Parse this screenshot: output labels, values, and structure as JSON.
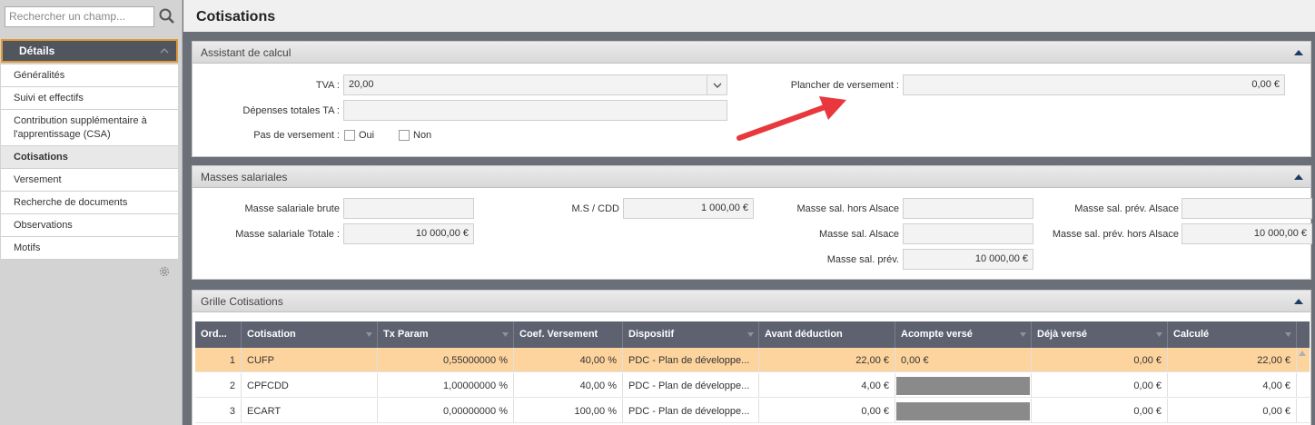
{
  "search": {
    "placeholder": "Rechercher un champ..."
  },
  "sidebar": {
    "header": "Détails",
    "items": [
      {
        "label": "Généralités"
      },
      {
        "label": "Suivi et effectifs"
      },
      {
        "label": "Contribution supplémentaire à l'apprentissage (CSA)"
      },
      {
        "label": "Cotisations"
      },
      {
        "label": "Versement"
      },
      {
        "label": "Recherche de documents"
      },
      {
        "label": "Observations"
      },
      {
        "label": "Motifs"
      }
    ]
  },
  "page": {
    "title": "Cotisations"
  },
  "assistant": {
    "title": "Assistant de calcul",
    "tva_label": "TVA :",
    "tva_value": "20,00",
    "depenses_label": "Dépenses totales TA :",
    "depenses_value": "",
    "pas_label": "Pas de versement :",
    "oui": "Oui",
    "non": "Non",
    "plancher_label": "Plancher de versement :",
    "plancher_value": "0,00 €"
  },
  "masses": {
    "title": "Masses salariales",
    "brute_label": "Masse salariale brute",
    "brute_value": "",
    "totale_label": "Masse salariale Totale :",
    "totale_value": "10 000,00 €",
    "ms_cdd_label": "M.S / CDD",
    "ms_cdd_value": "1 000,00 €",
    "hors_alsace_label": "Masse sal. hors Alsace",
    "hors_alsace_value": "",
    "alsace_label": "Masse sal. Alsace",
    "alsace_value": "",
    "prev_label": "Masse sal. prév.",
    "prev_value": "10 000,00 €",
    "prev_alsace_label": "Masse sal. prév. Alsace",
    "prev_alsace_value": "",
    "prev_hors_alsace_label": "Masse sal. prév. hors Alsace",
    "prev_hors_alsace_value": "10 000,00 €"
  },
  "grille": {
    "title": "Grille Cotisations",
    "columns": [
      "Ord...",
      "Cotisation",
      "Tx Param",
      "Coef. Versement",
      "Dispositif",
      "Avant déduction",
      "Acompte versé",
      "Déjà versé",
      "Calculé"
    ],
    "rows": [
      {
        "ord": "1",
        "cotisation": "CUFP",
        "tx": "0,55000000 %",
        "coef": "40,00 %",
        "dispositif": "PDC - Plan de développe...",
        "avant": "22,00 €",
        "acompte": "0,00 €",
        "deja": "0,00 €",
        "calcule": "22,00 €"
      },
      {
        "ord": "2",
        "cotisation": "CPFCDD",
        "tx": "1,00000000 %",
        "coef": "40,00 %",
        "dispositif": "PDC - Plan de développe...",
        "avant": "4,00 €",
        "acompte": "",
        "deja": "0,00 €",
        "calcule": "4,00 €"
      },
      {
        "ord": "3",
        "cotisation": "ECART",
        "tx": "0,00000000 %",
        "coef": "100,00 %",
        "dispositif": "PDC - Plan de développe...",
        "avant": "0,00 €",
        "acompte": "",
        "deja": "0,00 €",
        "calcule": "0,00 €"
      }
    ]
  },
  "colors": {
    "accent": "#e09a3a",
    "selected_row": "#fdd49e",
    "header_dark": "#51555e",
    "annotation_arrow": "#e8383d"
  },
  "icons": {
    "search": "search-icon",
    "gear": "gear-icon",
    "collapse": "chevron-up-icon",
    "dropdown": "chevron-down-icon"
  }
}
